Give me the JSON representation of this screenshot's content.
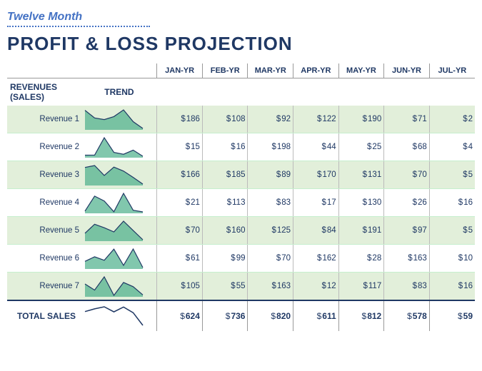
{
  "header": {
    "subtitle": "Twelve Month",
    "title": "PROFIT & LOSS PROJECTION"
  },
  "table": {
    "columns": [
      "JAN-YR",
      "FEB-YR",
      "MAR-YR",
      "APR-YR",
      "MAY-YR",
      "JUN-YR",
      "JUL-YR"
    ],
    "section_label": "REVENUES (SALES)",
    "trend_label": "TREND",
    "rows": [
      {
        "label": "Revenue 1",
        "values": [
          186,
          108,
          92,
          122,
          190,
          71,
          2
        ]
      },
      {
        "label": "Revenue 2",
        "values": [
          15,
          16,
          198,
          44,
          25,
          68,
          4
        ]
      },
      {
        "label": "Revenue 3",
        "values": [
          166,
          185,
          89,
          170,
          131,
          70,
          5
        ]
      },
      {
        "label": "Revenue 4",
        "values": [
          21,
          113,
          83,
          17,
          130,
          26,
          16
        ]
      },
      {
        "label": "Revenue 5",
        "values": [
          70,
          160,
          125,
          84,
          191,
          97,
          5
        ]
      },
      {
        "label": "Revenue 6",
        "values": [
          61,
          99,
          70,
          162,
          28,
          163,
          10
        ]
      },
      {
        "label": "Revenue 7",
        "values": [
          105,
          55,
          163,
          12,
          117,
          83,
          16
        ]
      }
    ],
    "total_label": "TOTAL SALES",
    "totals": [
      624,
      736,
      820,
      611,
      812,
      578,
      59
    ]
  }
}
